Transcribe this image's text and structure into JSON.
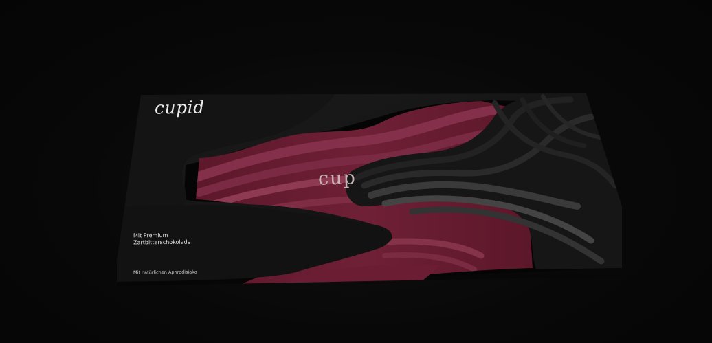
{
  "product": {
    "brand_logo": "cupid",
    "brand_center": "cupid",
    "claim_line1": "Mit Premium",
    "claim_line2": "Zartbitterschokolade",
    "footnote": "Mit natürlichen Aphrodisiaka"
  },
  "colors": {
    "background": "#070707",
    "box_black": "#141414",
    "wine_red": "#6e1f35",
    "wine_light": "#8d3a52",
    "grey_wave": "#3a3a3a"
  }
}
